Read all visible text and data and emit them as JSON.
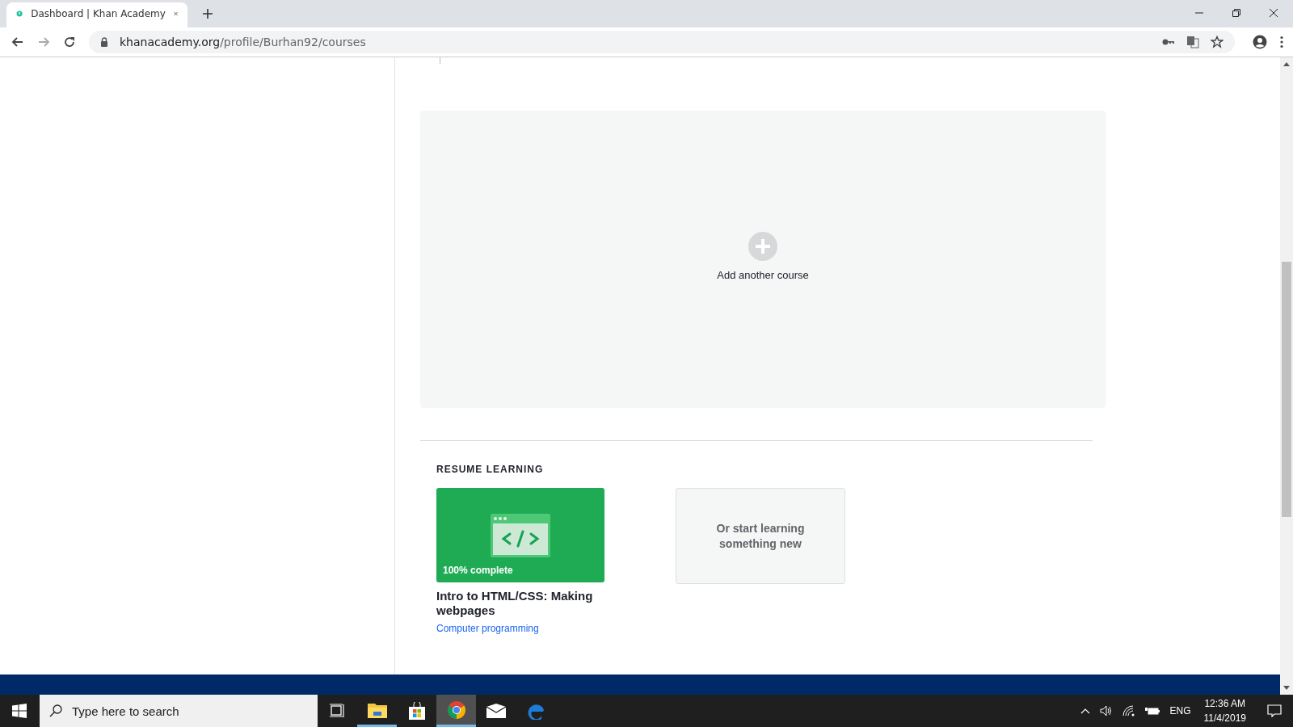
{
  "browser": {
    "tab_title": "Dashboard | Khan Academy",
    "url_host": "khanacademy.org",
    "url_path": "/profile/Burhan92/courses"
  },
  "add_course": {
    "label": "Add another course"
  },
  "resume": {
    "heading": "RESUME LEARNING",
    "course": {
      "progress": "100% complete",
      "title": "Intro to HTML/CSS: Making webpages",
      "subject": "Computer programming"
    },
    "start_new": "Or start learning something new"
  },
  "taskbar": {
    "search_placeholder": "Type here to search",
    "apps": [
      {
        "kind": "taskview",
        "running": false,
        "selected": false
      },
      {
        "kind": "explorer",
        "running": true,
        "selected": false
      },
      {
        "kind": "store",
        "running": false,
        "selected": false
      },
      {
        "kind": "chrome",
        "running": true,
        "selected": true
      },
      {
        "kind": "mail",
        "running": false,
        "selected": false
      },
      {
        "kind": "edge",
        "running": false,
        "selected": false
      }
    ],
    "language": "ENG",
    "time": "12:36 AM",
    "date": "11/4/2019"
  }
}
